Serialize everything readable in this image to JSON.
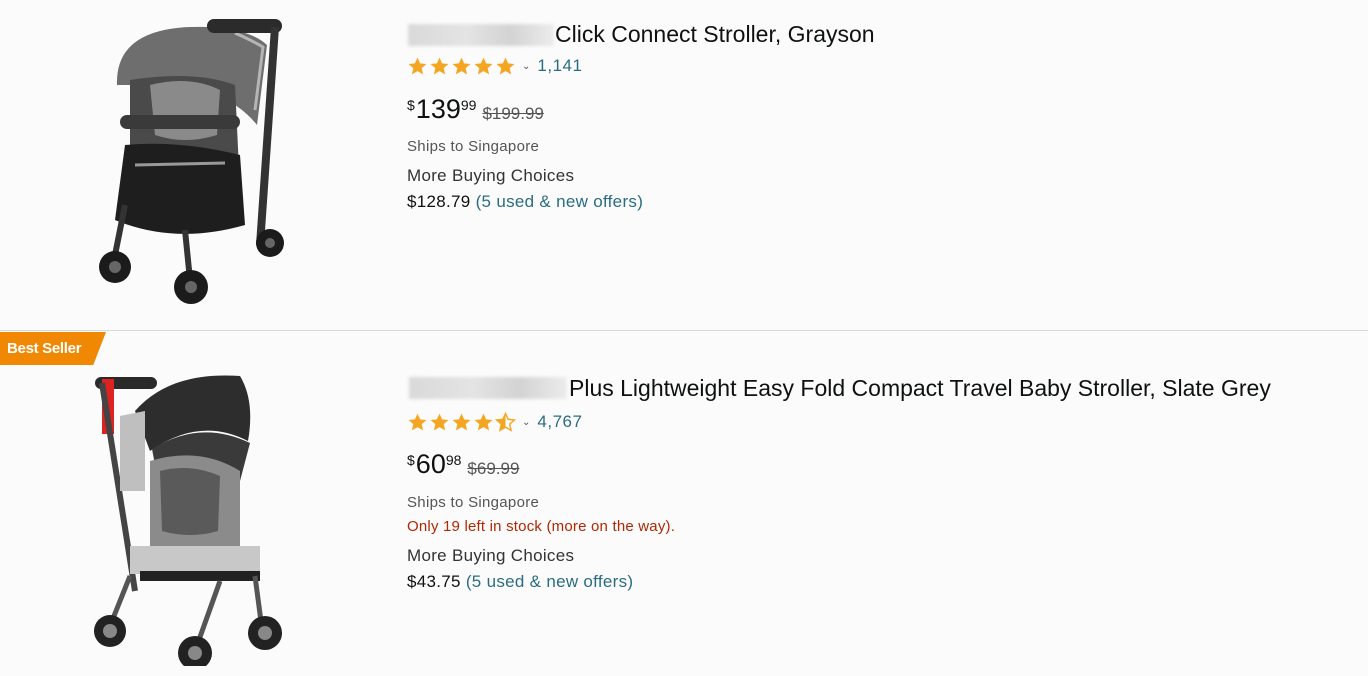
{
  "results": [
    {
      "title": "Click Connect Stroller, Grayson",
      "rating": 5,
      "rating_count": "1,141",
      "price_currency": "$",
      "price_whole": "139",
      "price_fraction": "99",
      "list_price": "$199.99",
      "shipping": "Ships to Singapore",
      "more_buying_label": "More Buying Choices",
      "offer_price": "$128.79",
      "offer_link": "(5 used & new offers)"
    },
    {
      "badge": "Best Seller",
      "title": "Plus Lightweight Easy Fold Compact Travel Baby Stroller, Slate Grey",
      "rating": 4.5,
      "rating_count": "4,767",
      "price_currency": "$",
      "price_whole": "60",
      "price_fraction": "98",
      "list_price": "$69.99",
      "shipping": "Ships to Singapore",
      "stock_note": "Only 19 left in stock (more on the way).",
      "more_buying_label": "More Buying Choices",
      "offer_price": "$43.75",
      "offer_link": "(5 used & new offers)"
    }
  ],
  "colors": {
    "star": "#f4a622",
    "badge": "#f08804",
    "link": "#2a6d82",
    "stock": "#b12704"
  },
  "icons": {
    "star_full": "star-icon",
    "star_half": "half-star-icon",
    "caret": "chevron-down-icon"
  }
}
